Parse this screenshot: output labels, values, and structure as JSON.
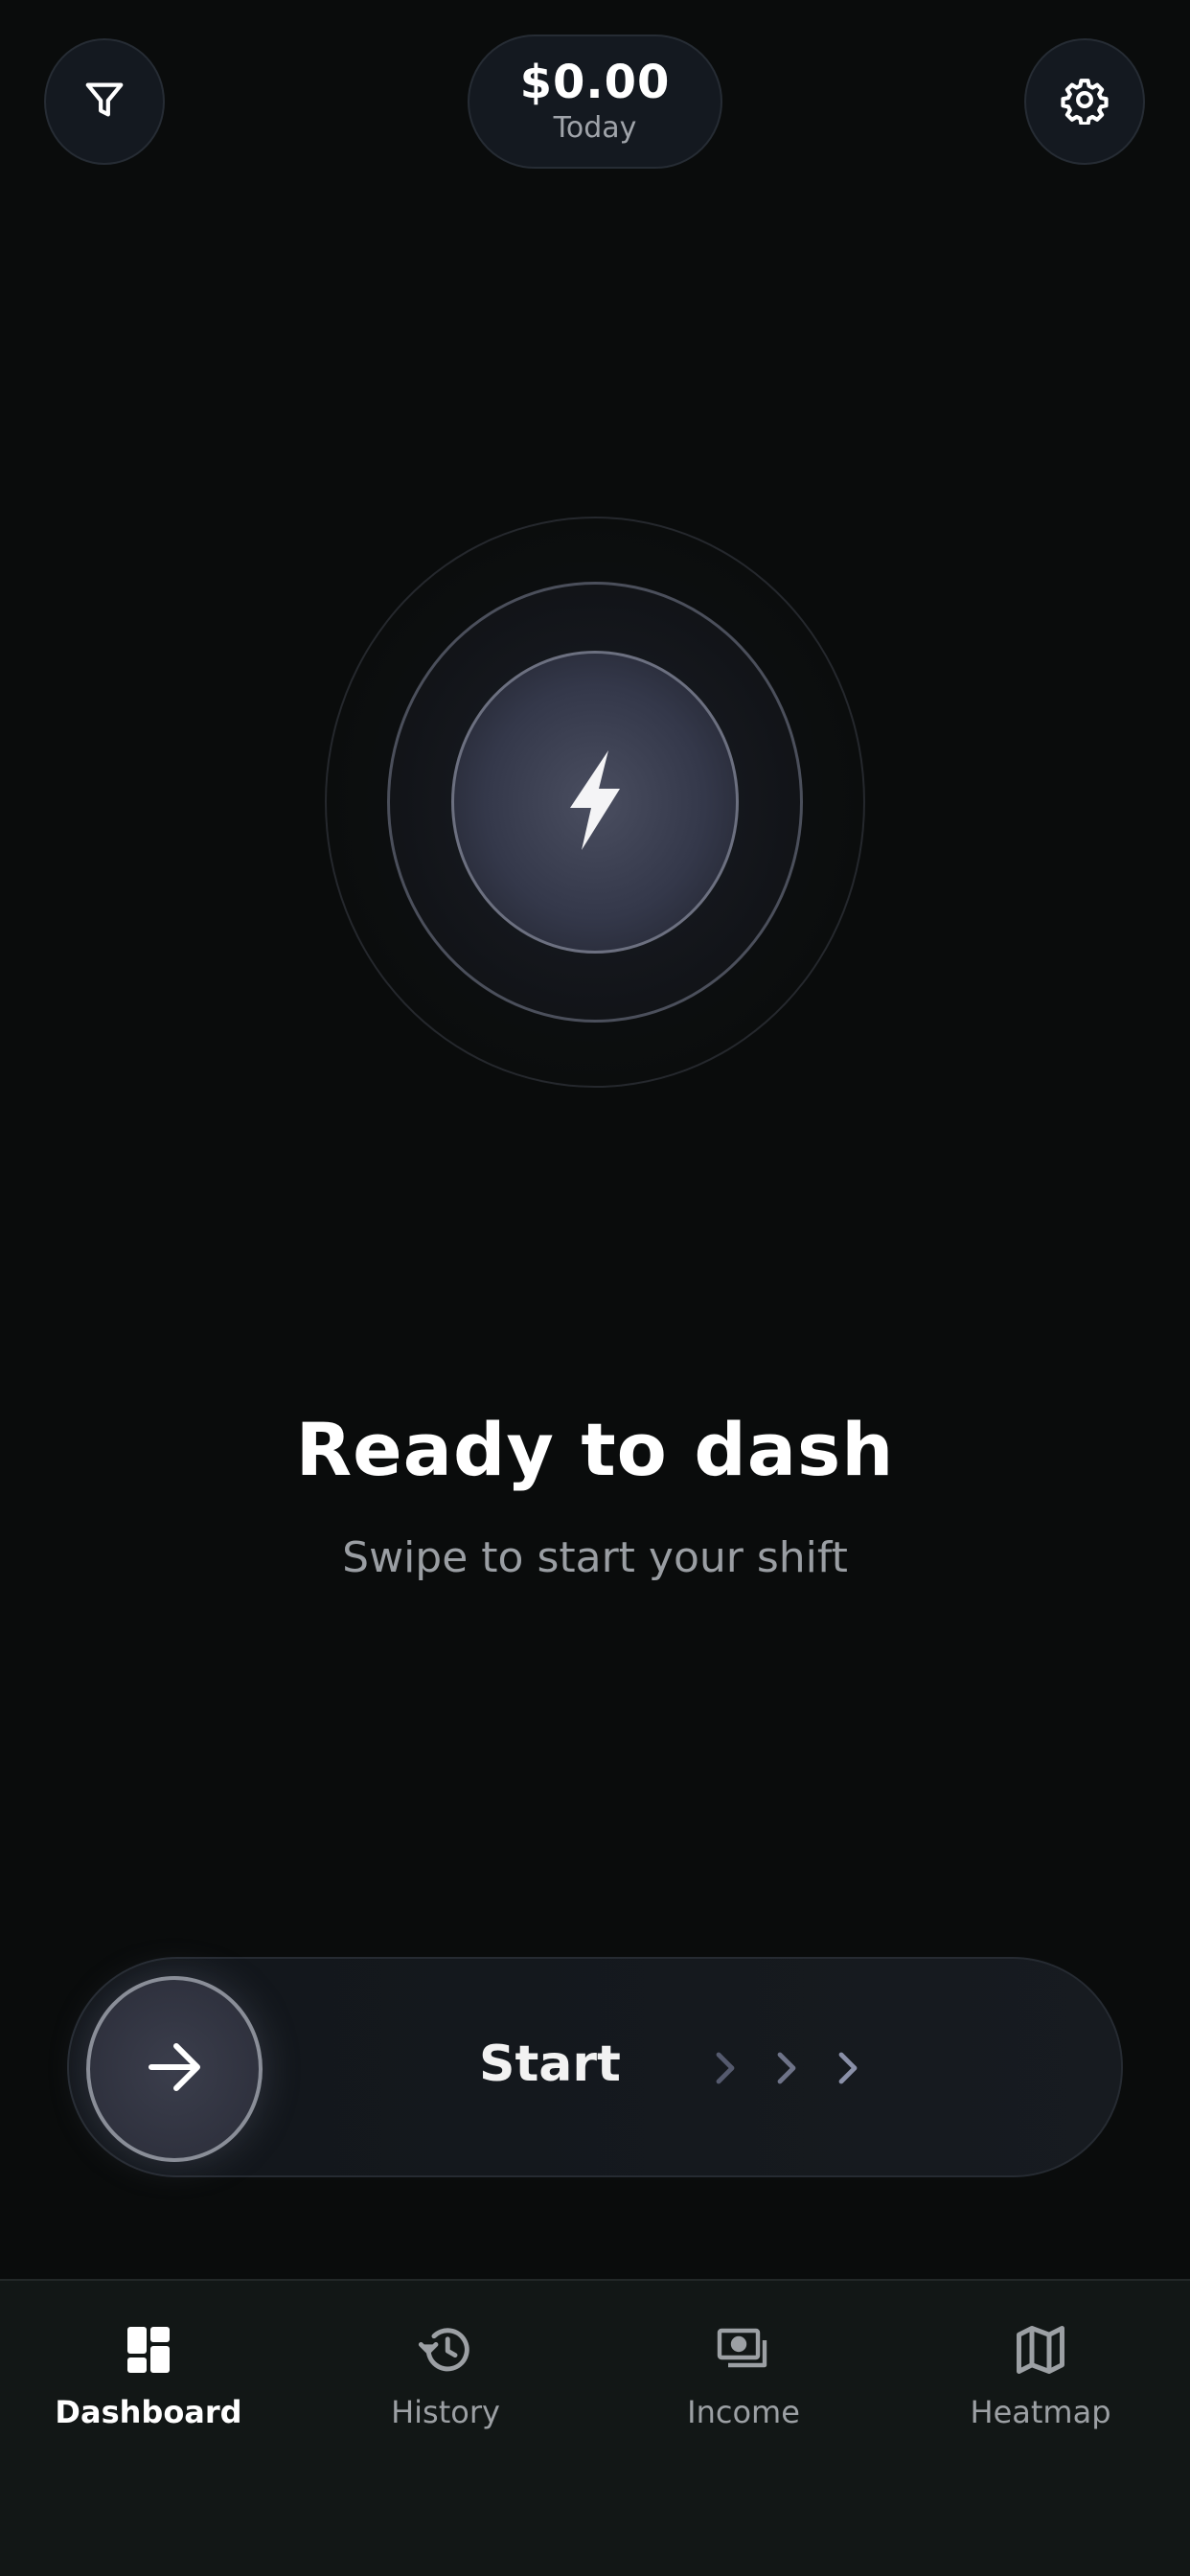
{
  "header": {
    "earnings_amount": "$0.00",
    "earnings_label": "Today",
    "filter_icon": "filter-icon",
    "settings_icon": "gear-icon"
  },
  "center": {
    "icon": "lightning-bolt-icon",
    "title": "Ready to dash",
    "subtitle": "Swipe to start your shift"
  },
  "slider": {
    "label": "Start",
    "knob_icon": "arrow-right-icon",
    "chevron_icon": "chevron-right-icon"
  },
  "bottom_nav": {
    "items": [
      {
        "label": "Dashboard",
        "icon": "dashboard-icon",
        "active": true
      },
      {
        "label": "History",
        "icon": "history-icon",
        "active": false
      },
      {
        "label": "Income",
        "icon": "income-icon",
        "active": false
      },
      {
        "label": "Heatmap",
        "icon": "map-icon",
        "active": false
      }
    ]
  },
  "colors": {
    "background": "#0a0c0c",
    "surface": "#141920",
    "nav_background": "#121716",
    "text_primary": "#ffffff",
    "text_secondary": "#9a9ea3"
  }
}
